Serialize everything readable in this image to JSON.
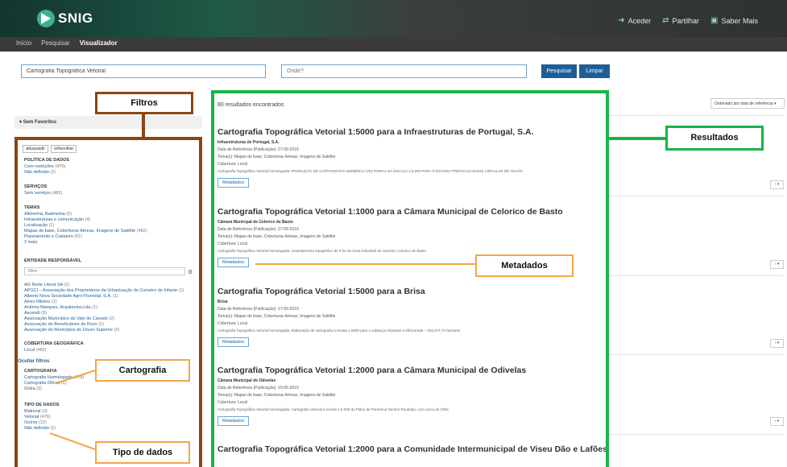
{
  "header": {
    "logo_text": "SNIG",
    "links": [
      {
        "icon": "login-icon",
        "label": "Aceder"
      },
      {
        "icon": "share-icon",
        "label": "Partilhar"
      },
      {
        "icon": "info-icon",
        "label": "Saber Mais"
      }
    ]
  },
  "nav": {
    "items": [
      "Início",
      "Pesquisar",
      "Visualizador"
    ],
    "active": "Visualizador"
  },
  "search": {
    "query": "Cartografia Topográfica Vetorial",
    "where_placeholder": "Onde?",
    "search_label": "Pesquisar",
    "clear_label": "Limpar"
  },
  "favorites": {
    "label": "▾ Sem Favoritos"
  },
  "filters": {
    "expand_label": "Expandir",
    "collapse_label": "Recolher",
    "sections": {
      "policy": {
        "title": "POLÍTICA DE DADOS",
        "items": [
          {
            "label": "Com restrições",
            "count": "(476)"
          },
          {
            "label": "Não definido",
            "count": "(2)"
          }
        ]
      },
      "services": {
        "title": "SERVIÇOS",
        "items": [
          {
            "label": "Sem serviços",
            "count": "(482)"
          }
        ]
      },
      "themes": {
        "title": "TEMAS",
        "items": [
          {
            "label": "Altimetria, Batimetria",
            "count": "(6)"
          },
          {
            "label": "Infraestruturas e comunicação",
            "count": "(4)"
          },
          {
            "label": "Localização",
            "count": "(1)"
          },
          {
            "label": "Mapas de base, Coberturas Aéreas, Imagens de Satélite",
            "count": "(482)"
          },
          {
            "label": "Planeamento e Cadastro",
            "count": "(51)"
          },
          {
            "label": "2 mais",
            "count": ""
          }
        ]
      },
      "entity": {
        "title": "ENTIDADE RESPONSÁVEL",
        "filter_placeholder": "Filtro",
        "items": [
          {
            "label": "AG Norte Litoral SA",
            "count": "(1)"
          },
          {
            "label": "APGCI – Associação dos Proprietários da Urbanização do Cumeiro do Infante",
            "count": "(1)"
          },
          {
            "label": "Alberto Nova Sociedade Agro-Florestal, S.A.",
            "count": "(1)"
          },
          {
            "label": "Alves Ribeiro",
            "count": "(1)"
          },
          {
            "label": "António Marques, Arquitectos,Lda",
            "count": "(1)"
          },
          {
            "label": "Ascendi",
            "count": "(8)"
          },
          {
            "label": "Associação Municípios do Vale do Cávado",
            "count": "(2)"
          },
          {
            "label": "Associação de Beneficiários do Roxo",
            "count": "(1)"
          },
          {
            "label": "Associação de Municípios do Douro Superior",
            "count": "(2)"
          }
        ]
      },
      "coverage": {
        "title": "COBERTURA GEOGRÁFICA",
        "items": [
          {
            "label": "Local",
            "count": "(482)"
          }
        ]
      },
      "hide_filters": "Ocultar filtros",
      "cartography": {
        "title": "CARTOGRAFIA",
        "items": [
          {
            "label": "Cartografia Homologada",
            "count": "(478)"
          },
          {
            "label": "Cartografia Oficial",
            "count": "(1)"
          },
          {
            "label": "Outra",
            "count": "(3)"
          }
        ]
      },
      "datatype": {
        "title": "TIPO DE DADOS",
        "items": [
          {
            "label": "Matricial",
            "count": "(3)"
          },
          {
            "label": "Vetorial",
            "count": "(476)"
          },
          {
            "label": "Outros",
            "count": "(22)"
          },
          {
            "label": "Não definido",
            "count": "(1)"
          }
        ]
      }
    }
  },
  "results": {
    "count_text": "80 resultados encontrados",
    "sort_label": "Ordenado por data de referência ▾",
    "metadata_label": "Metadados",
    "more_label": "⁝ ▾",
    "items": [
      {
        "title": "Cartografia Topográfica Vetorial 1:5000 para a Infraestruturas de Portugal, S.A.",
        "org": "Infraestruturas de Portugal, S.A.",
        "date": "Data de Referência (Publicação): 27-09-2019",
        "themes": "Tema(s): Mapas de base, Coberturas Aéreas, Imagens de Satélite",
        "coverage": "Cobertura: Local",
        "desc": "Cartografia Topográfica Vetorial homologada: PRODUÇÃO DE CARTOGRAFIA NUMÉRICA VECTORIAL NA ESCALA 1:5.000 PARA O ESTUDO PRÉVIO DA EN125 CIRCULAR DE OLHÃO"
      },
      {
        "title": "Cartografia Topográfica Vetorial 1:1000 para a Câmara Municipal de Celorico de Basto",
        "org": "Câmara Municipal de Celorico de Basto",
        "date": "Data de Referência (Publicação): 27-09-2019",
        "themes": "Tema(s): Mapas de base, Coberturas Aéreas, Imagens de Satélite",
        "coverage": "Cobertura: Local",
        "desc": "Cartografia Topográfica Vetorial homologada: Levantamento topográfico de 9 ha da Zona Industrial de Lameira, Celorico de Basto"
      },
      {
        "title": "Cartografia Topográfica Vetorial 1:5000 para a Brisa",
        "org": "Brisa",
        "date": "Data de Referência (Publicação): 17-09-2019",
        "themes": "Tema(s): Mapas de base, Coberturas Aéreas, Imagens de Satélite",
        "coverage": "Cobertura: Local",
        "desc": "Cartografia Topográfica Vetorial homologada: Elaboração de cartografia à escala 1:5000 para o sublanço Abrantes e Alferrarede – 633,272,72 hectares"
      },
      {
        "title": "Cartografia Topográfica Vetorial 1:2000 para a Câmara Municipal de Odivelas",
        "org": "Câmara Municipal de Odivelas",
        "date": "Data de Referência (Publicação): 15-05-2019",
        "themes": "Tema(s): Mapas de base, Coberturas Aéreas, Imagens de Satélite",
        "coverage": "Cobertura: Local",
        "desc": "Cartografia Topográfica Vetorial homologada: Cartografia Vetorial à escala 1:2.000 do Plano de Pormenor Senhor Roubado, com cerca de 33ha"
      },
      {
        "title": "Cartografia Topográfica Vetorial 1:2000 para a Comunidade Intermunicipal de Viseu Dão e Lafões"
      }
    ]
  },
  "annotations": {
    "filtros": "Filtros",
    "resultados": "Resultados",
    "metadados": "Metadados",
    "cartografia": "Cartografia",
    "tipo_dados": "Tipo de dados"
  },
  "colors": {
    "filters_frame": "#8b4513",
    "results_frame": "#19b34a",
    "callout": "#f2a64a",
    "button_blue": "#1f5d97"
  }
}
